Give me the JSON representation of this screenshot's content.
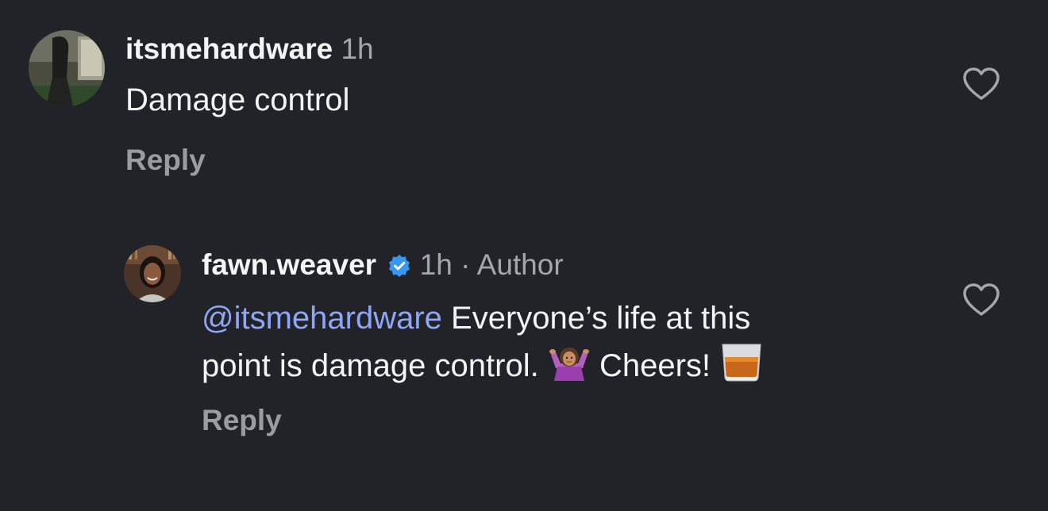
{
  "comments": [
    {
      "username": "itsmehardware",
      "time": "1h",
      "text": "Damage control",
      "reply_label": "Reply",
      "like_icon": "heart-outline-icon"
    },
    {
      "username": "fawn.weaver",
      "verified_icon": "verified-badge-icon",
      "time": "1h",
      "separator": "·",
      "author_label": "Author",
      "mention": "@itsmehardware",
      "text_line1": " Everyone’s life at this",
      "text_line2": "point is damage control. ",
      "text_line3": " Cheers! ",
      "emoji_1": "woman-shrugging-emoji",
      "emoji_2": "whiskey-glass-emoji",
      "reply_label": "Reply",
      "like_icon": "heart-outline-icon"
    }
  ],
  "colors": {
    "background": "#222328",
    "mention": "#8ea6f7",
    "verified": "#3897f0",
    "meta": "#a5a6ab"
  }
}
